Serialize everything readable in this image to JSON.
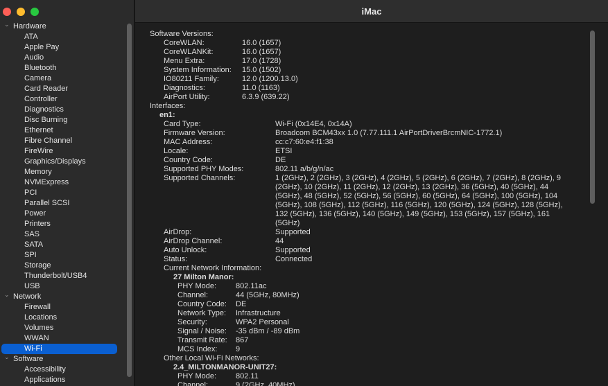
{
  "window": {
    "title": "iMac"
  },
  "sidebar": {
    "categories": [
      {
        "label": "Hardware",
        "items": [
          "ATA",
          "Apple Pay",
          "Audio",
          "Bluetooth",
          "Camera",
          "Card Reader",
          "Controller",
          "Diagnostics",
          "Disc Burning",
          "Ethernet",
          "Fibre Channel",
          "FireWire",
          "Graphics/Displays",
          "Memory",
          "NVMExpress",
          "PCI",
          "Parallel SCSI",
          "Power",
          "Printers",
          "SAS",
          "SATA",
          "SPI",
          "Storage",
          "Thunderbolt/USB4",
          "USB"
        ]
      },
      {
        "label": "Network",
        "items": [
          "Firewall",
          "Locations",
          "Volumes",
          "WWAN",
          "Wi-Fi"
        ]
      },
      {
        "label": "Software",
        "items": [
          "Accessibility",
          "Applications"
        ]
      }
    ],
    "selected": "Wi-Fi"
  },
  "content": {
    "software_versions_label": "Software Versions:",
    "software_versions": [
      {
        "k": "CoreWLAN:",
        "v": "16.0 (1657)"
      },
      {
        "k": "CoreWLANKit:",
        "v": "16.0 (1657)"
      },
      {
        "k": "Menu Extra:",
        "v": "17.0 (1728)"
      },
      {
        "k": "System Information:",
        "v": "15.0 (1502)"
      },
      {
        "k": "IO80211 Family:",
        "v": "12.0 (1200.13.0)"
      },
      {
        "k": "Diagnostics:",
        "v": "11.0 (1163)"
      },
      {
        "k": "AirPort Utility:",
        "v": "6.3.9 (639.22)"
      }
    ],
    "interfaces_label": "Interfaces:",
    "interface_name": "en1:",
    "interface_props": [
      {
        "k": "Card Type:",
        "v": "Wi-Fi  (0x14E4, 0x14A)"
      },
      {
        "k": "Firmware Version:",
        "v": "Broadcom BCM43xx 1.0 (7.77.111.1 AirPortDriverBrcmNIC-1772.1)"
      },
      {
        "k": "MAC Address:",
        "v": "cc:c7:60:e4:f1:38"
      },
      {
        "k": "Locale:",
        "v": "ETSI"
      },
      {
        "k": "Country Code:",
        "v": "DE"
      },
      {
        "k": "Supported PHY Modes:",
        "v": "802.11 a/b/g/n/ac"
      }
    ],
    "supported_channels_label": "Supported Channels:",
    "supported_channels_lines": [
      "1 (2GHz), 2 (2GHz), 3 (2GHz), 4 (2GHz), 5 (2GHz), 6 (2GHz), 7 (2GHz), 8 (2GHz), 9",
      "(2GHz), 10 (2GHz), 11 (2GHz), 12 (2GHz), 13 (2GHz), 36 (5GHz), 40 (5GHz), 44",
      "(5GHz), 48 (5GHz), 52 (5GHz), 56 (5GHz), 60 (5GHz), 64 (5GHz), 100 (5GHz), 104",
      "(5GHz), 108 (5GHz), 112 (5GHz), 116 (5GHz), 120 (5GHz), 124 (5GHz), 128 (5GHz),",
      "132 (5GHz), 136 (5GHz), 140 (5GHz), 149 (5GHz), 153 (5GHz), 157 (5GHz), 161",
      "(5GHz)"
    ],
    "interface_props2": [
      {
        "k": "AirDrop:",
        "v": "Supported"
      },
      {
        "k": "AirDrop Channel:",
        "v": "44"
      },
      {
        "k": "Auto Unlock:",
        "v": "Supported"
      },
      {
        "k": "Status:",
        "v": "Connected"
      }
    ],
    "current_network_label": "Current Network Information:",
    "current_network_name": "27 Milton Manor:",
    "current_network_props": [
      {
        "k": "PHY Mode:",
        "v": "802.11ac"
      },
      {
        "k": "Channel:",
        "v": "44 (5GHz, 80MHz)"
      },
      {
        "k": "Country Code:",
        "v": "DE"
      },
      {
        "k": "Network Type:",
        "v": "Infrastructure"
      },
      {
        "k": "Security:",
        "v": "WPA2 Personal"
      },
      {
        "k": "Signal / Noise:",
        "v": "-35 dBm / -89 dBm"
      },
      {
        "k": "Transmit Rate:",
        "v": "867"
      },
      {
        "k": "MCS Index:",
        "v": "9"
      }
    ],
    "other_networks_label": "Other Local Wi-Fi Networks:",
    "other_network_name": "2.4_MILTONMANOR-UNIT27:",
    "other_network_props": [
      {
        "k": "PHY Mode:",
        "v": "802.11"
      },
      {
        "k": "Channel:",
        "v": "9 (2GHz, 40MHz)"
      }
    ]
  }
}
